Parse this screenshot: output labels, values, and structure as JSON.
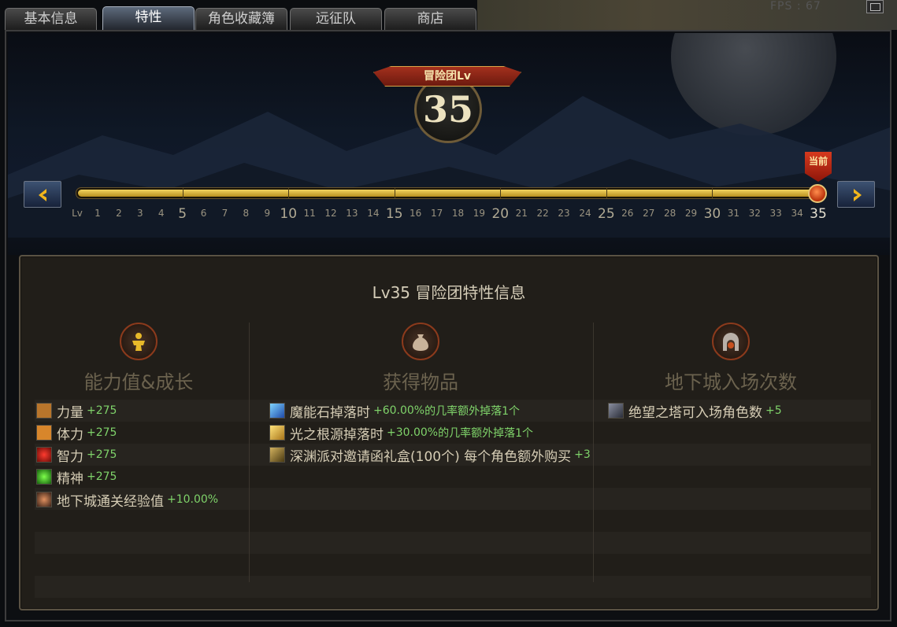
{
  "tabs": [
    "基本信息",
    "特性",
    "角色收藏簿",
    "远征队",
    "商店"
  ],
  "active_tab": 1,
  "fps_text": "FPS : 67",
  "badge": {
    "ribbon": "冒险团Lv",
    "level": "35"
  },
  "slider": {
    "prefix": "Lv",
    "min": 1,
    "max": 35,
    "current": 35,
    "labels": [
      "1",
      "2",
      "3",
      "4",
      "5",
      "6",
      "7",
      "8",
      "9",
      "10",
      "11",
      "12",
      "13",
      "14",
      "15",
      "16",
      "17",
      "18",
      "19",
      "20",
      "21",
      "22",
      "23",
      "24",
      "25",
      "26",
      "27",
      "28",
      "29",
      "30",
      "31",
      "32",
      "33",
      "34",
      "35"
    ],
    "current_flag": "当前"
  },
  "panel": {
    "title": "Lv35  冒险团特性信息",
    "columns": [
      {
        "title": "能力值&成长",
        "icon": "gold-statue-icon",
        "items": [
          {
            "icon": "strength-icon",
            "name": "力量",
            "value": "+275"
          },
          {
            "icon": "vitality-icon",
            "name": "体力",
            "value": "+275"
          },
          {
            "icon": "intelligence-icon",
            "name": "智力",
            "value": "+275"
          },
          {
            "icon": "spirit-icon",
            "name": "精神",
            "value": "+275"
          },
          {
            "icon": "dungeon-exp-icon",
            "name": "地下城通关经验值",
            "value": "+10.00%"
          }
        ]
      },
      {
        "title": "获得物品",
        "icon": "pouch-icon",
        "items": [
          {
            "icon": "magic-stone-icon",
            "name": "魔能石掉落时",
            "value": "+60.00%",
            "suffix": "的几率额外掉落1个"
          },
          {
            "icon": "light-root-icon",
            "name": "光之根源掉落时",
            "value": "+30.00%",
            "suffix": "的几率额外掉落1个"
          },
          {
            "icon": "gift-box-icon",
            "name": "深渊派对邀请函礼盒(100个) 每个角色额外购买",
            "value": "+3"
          }
        ]
      },
      {
        "title": "地下城入场次数",
        "icon": "dungeon-gate-icon",
        "items": [
          {
            "icon": "despair-tower-icon",
            "name": "绝望之塔可入场角色数",
            "value": "+5"
          }
        ]
      }
    ]
  }
}
